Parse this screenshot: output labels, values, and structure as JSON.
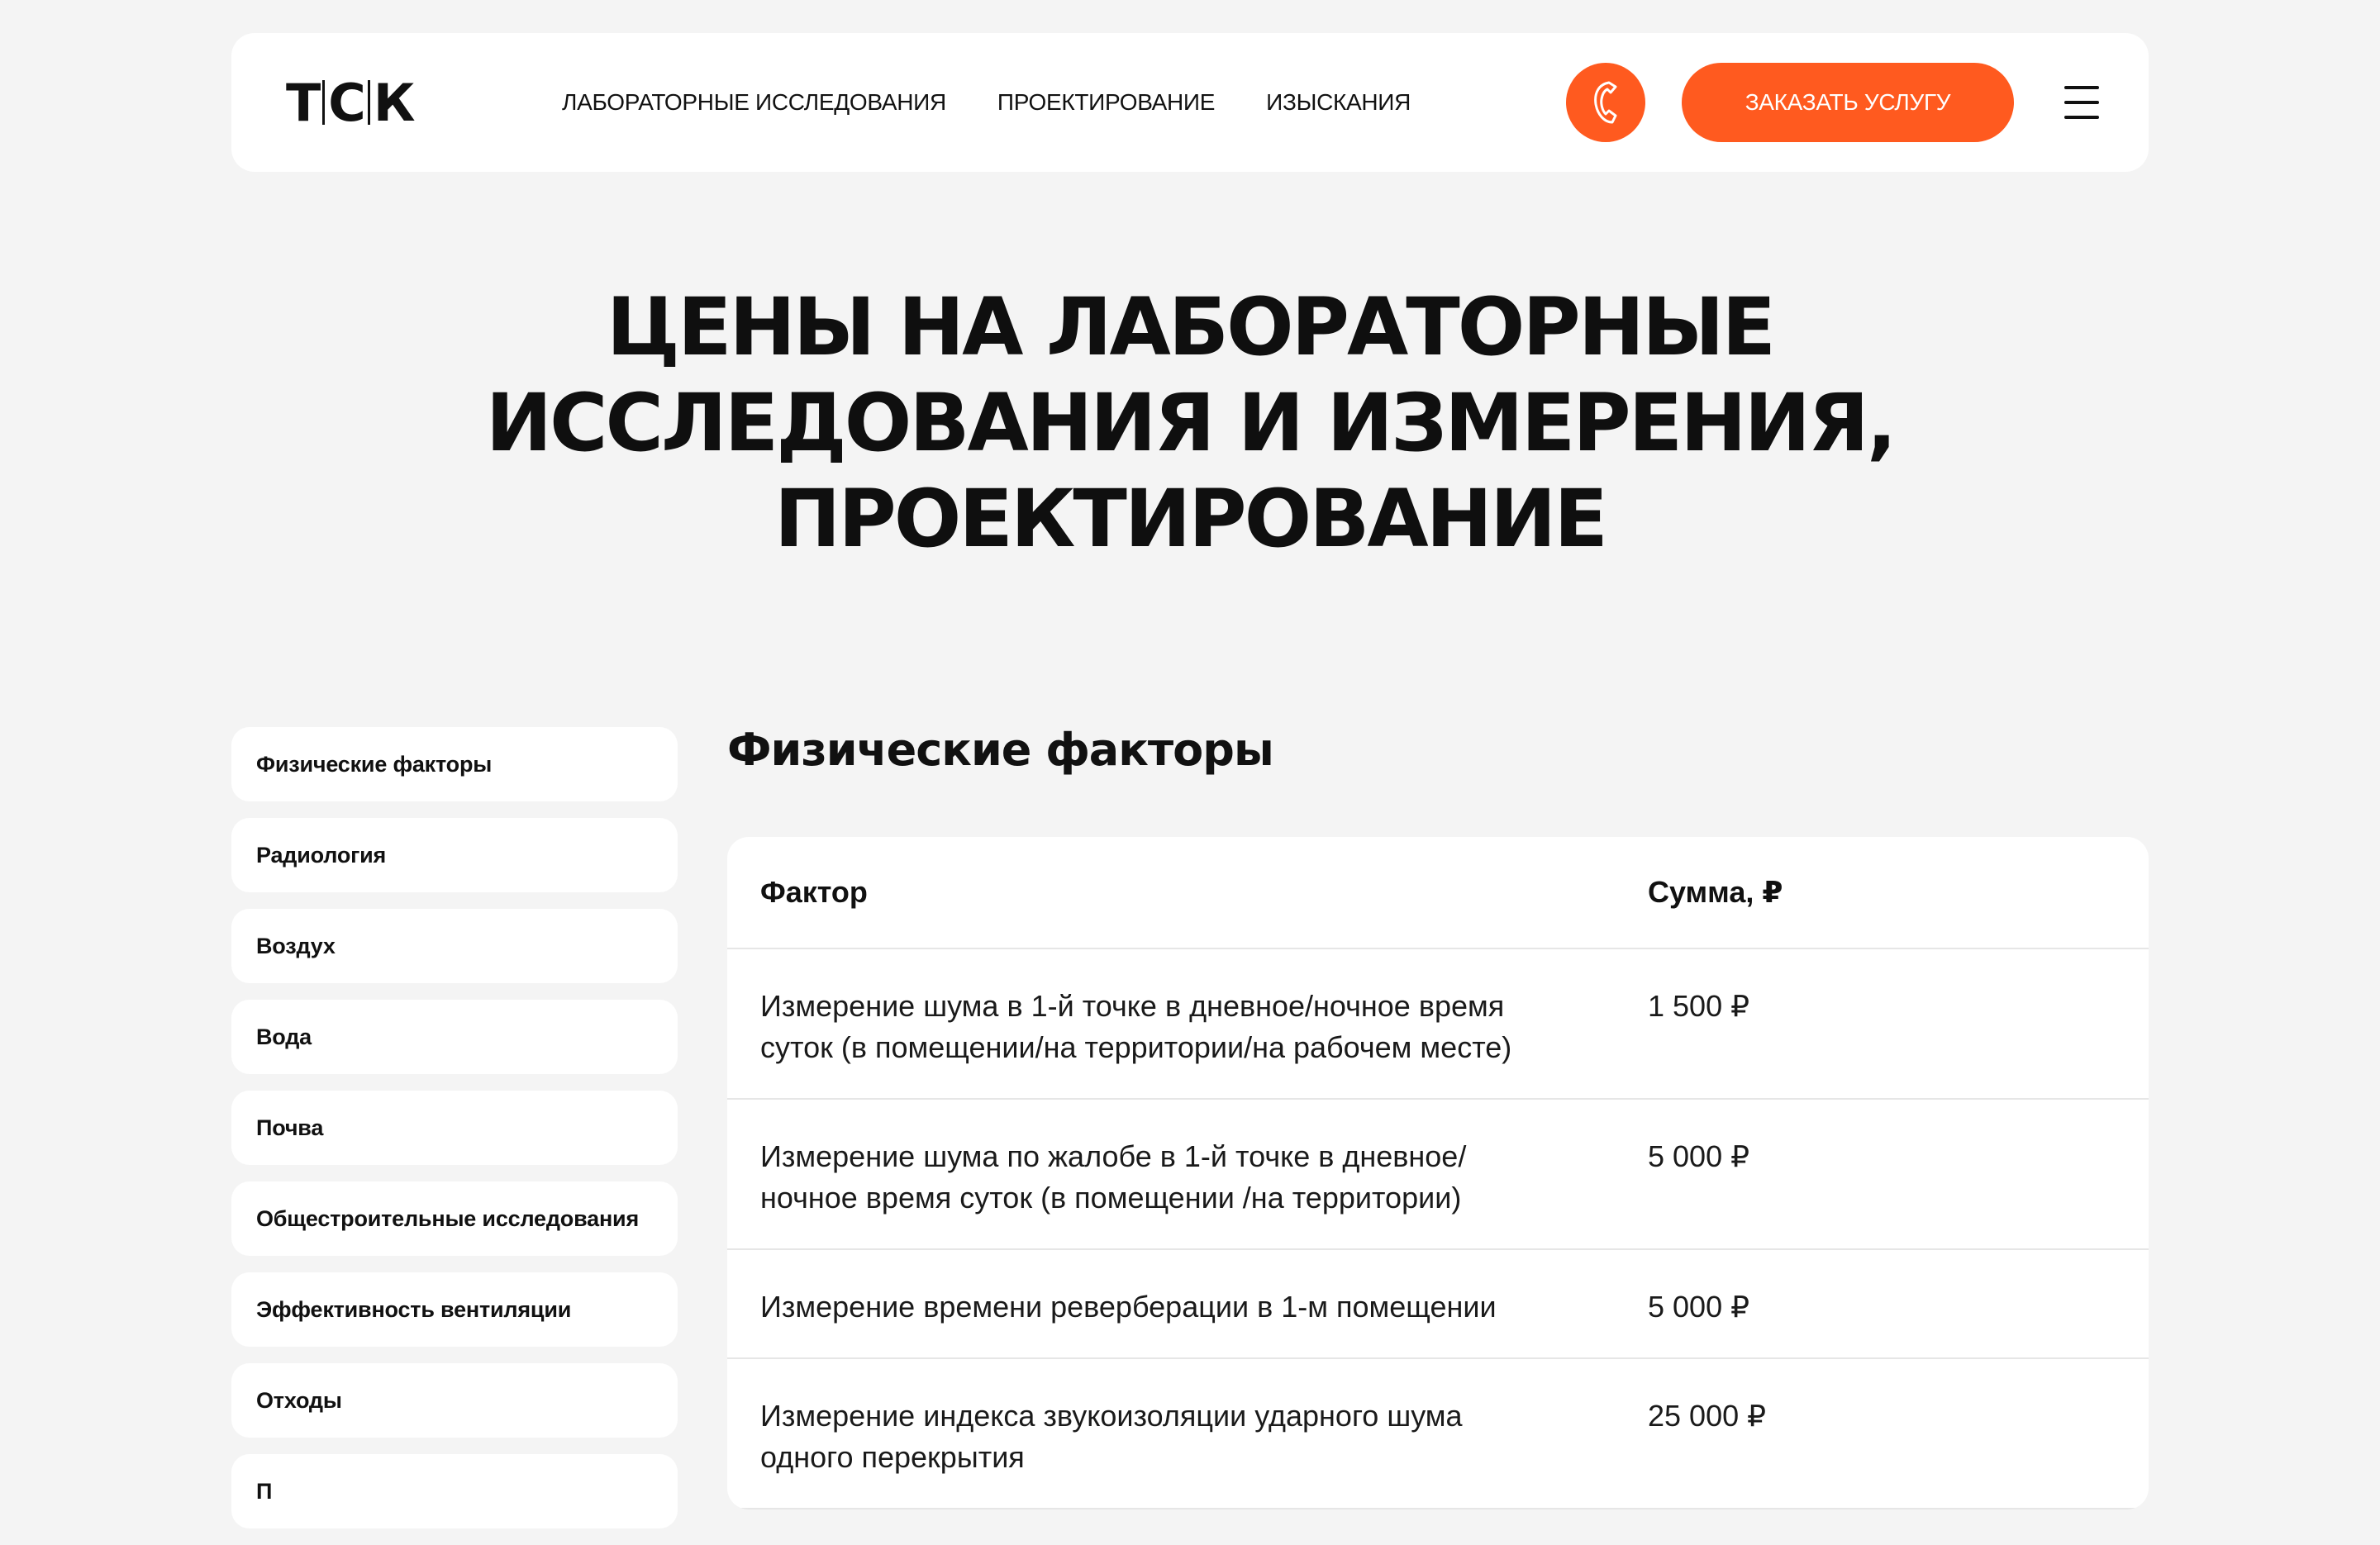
{
  "brand": {
    "logo_left": "Т",
    "logo_mid": "С",
    "logo_right": "К",
    "accent_color": "#ff5a1f"
  },
  "header": {
    "nav": [
      {
        "label": "ЛАБОРАТОРНЫЕ ИССЛЕДОВАНИЯ"
      },
      {
        "label": "ПРОЕКТИРОВАНИЕ"
      },
      {
        "label": "ИЗЫСКАНИЯ"
      }
    ],
    "phone_icon": "phone-icon",
    "order_button": "ЗАКАЗАТЬ УСЛУГУ",
    "menu_icon": "hamburger-menu-icon"
  },
  "hero": {
    "title_lines": [
      "ЦЕНЫ НА ЛАБОРАТОРНЫЕ",
      "ИССЛЕДОВАНИЯ И ИЗМЕРЕНИЯ,",
      "ПРОЕКТИРОВАНИЕ"
    ]
  },
  "sidebar": {
    "items": [
      {
        "label": "Физические факторы"
      },
      {
        "label": "Радиология"
      },
      {
        "label": "Воздух"
      },
      {
        "label": "Вода"
      },
      {
        "label": "Почва"
      },
      {
        "label": "Общестроительные исследования"
      },
      {
        "label": "Эффективность вентиляции"
      },
      {
        "label": "Отходы"
      },
      {
        "label": "П"
      }
    ]
  },
  "content": {
    "section_title": "Физические факторы",
    "table": {
      "headers": {
        "factor": "Фактор",
        "sum": "Сумма, ₽"
      },
      "rows": [
        {
          "factor": "Измерение шума в 1-й точке в дневное/ночное время суток (в помещении/на территории/на рабочем месте)",
          "sum": "1 500 ₽"
        },
        {
          "factor": "Измерение шума по жалобе в 1-й точке в дневное/ночное время суток (в помещении /на территории)",
          "sum": "5 000 ₽"
        },
        {
          "factor": "Измерение времени реверберации в 1-м помещении",
          "sum": "5 000 ₽"
        },
        {
          "factor": "Измерение индекса звукоизоляции ударного шума одного перекрытия",
          "sum": "25 000 ₽"
        }
      ]
    }
  }
}
